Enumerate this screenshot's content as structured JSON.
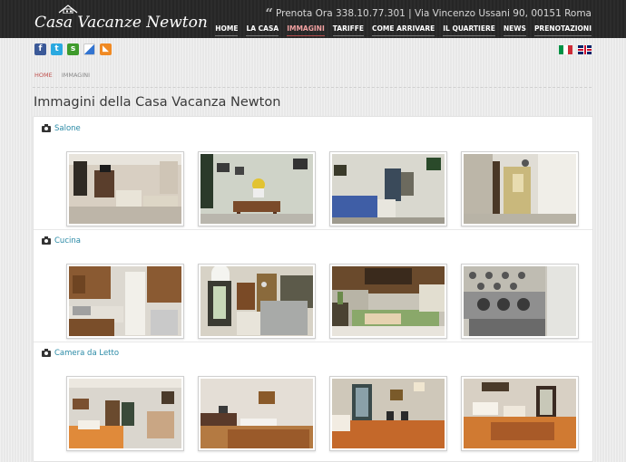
{
  "header": {
    "logo_text": "Casa Vacanze Newton",
    "contact_text": "Prenota Ora 338.10.77.301 | Via Vincenzo Ussani 90, 00151 Roma",
    "quote_mark": "“",
    "nav": [
      {
        "label": "HOME",
        "active": false
      },
      {
        "label": "LA CASA",
        "active": false
      },
      {
        "label": "IMMAGINI",
        "active": true
      },
      {
        "label": "TARIFFE",
        "active": false
      },
      {
        "label": "COME ARRIVARE",
        "active": false
      },
      {
        "label": "IL QUARTIERE",
        "active": false
      },
      {
        "label": "NEWS",
        "active": false
      },
      {
        "label": "PRENOTAZIONI",
        "active": false
      }
    ]
  },
  "social": [
    {
      "name": "facebook",
      "glyph": "f",
      "color": "#3b5998"
    },
    {
      "name": "twitter",
      "glyph": "t",
      "color": "#2aa9e0"
    },
    {
      "name": "stumbleupon",
      "glyph": "s",
      "color": "#3f9b2c"
    },
    {
      "name": "delicious",
      "glyph": "d",
      "color": "#3274d1"
    },
    {
      "name": "rss",
      "glyph": "r",
      "color": "#f08a24"
    }
  ],
  "languages": [
    "italian-flag",
    "english-flag"
  ],
  "breadcrumb": {
    "home": "HOME",
    "current": "IMMAGINI"
  },
  "page_title": "Immagini della Casa Vacanza Newton",
  "sections": [
    {
      "label": "Salone",
      "photos": [
        "salone-1",
        "salone-2",
        "salone-3",
        "salone-4"
      ]
    },
    {
      "label": "Cucina",
      "photos": [
        "cucina-1",
        "cucina-2",
        "cucina-3",
        "cucina-4"
      ]
    },
    {
      "label": "Camera da Letto",
      "photos": [
        "camera-1",
        "camera-2",
        "camera-3",
        "camera-4"
      ]
    }
  ]
}
